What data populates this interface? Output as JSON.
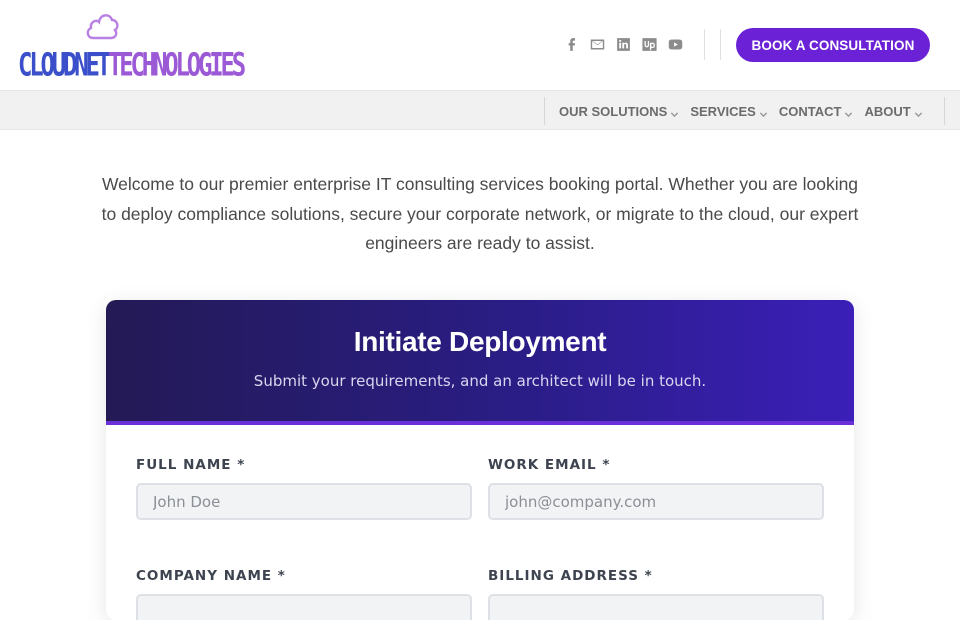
{
  "header": {
    "logo": {
      "part1": "CLOUDNET",
      "part2": "TECHNOLOGIES"
    },
    "socials": [
      {
        "icon": "facebook-icon"
      },
      {
        "icon": "email-icon"
      },
      {
        "icon": "linkedin-icon"
      },
      {
        "icon": "upwork-icon"
      },
      {
        "icon": "youtube-icon"
      }
    ],
    "cta_label": "BOOK A CONSULTATION"
  },
  "nav": {
    "items": [
      {
        "label": "OUR SOLUTIONS"
      },
      {
        "label": "SERVICES"
      },
      {
        "label": "CONTACT"
      },
      {
        "label": "ABOUT"
      }
    ]
  },
  "intro": {
    "text": "Welcome to our premier enterprise IT consulting services booking portal. Whether you are looking to deploy compliance solutions, secure your corporate network, or migrate to the cloud, our expert engineers are ready to assist."
  },
  "form": {
    "title": "Initiate Deployment",
    "subtitle": "Submit your requirements, and an architect will be in touch.",
    "fields": {
      "full_name": {
        "label": "FULL NAME *",
        "placeholder": "John Doe",
        "value": ""
      },
      "work_email": {
        "label": "WORK EMAIL *",
        "placeholder": "john@company.com",
        "value": ""
      },
      "company_name": {
        "label": "COMPANY NAME *",
        "placeholder": "",
        "value": ""
      },
      "billing_address": {
        "label": "BILLING ADDRESS *",
        "placeholder": "",
        "value": ""
      }
    }
  },
  "colors": {
    "brand_purple": "#6b21d6",
    "logo_blue": "#3a4fc9",
    "logo_violet": "#9b59d6",
    "card_header_start": "#231a55",
    "card_header_end": "#3b1fb8"
  }
}
